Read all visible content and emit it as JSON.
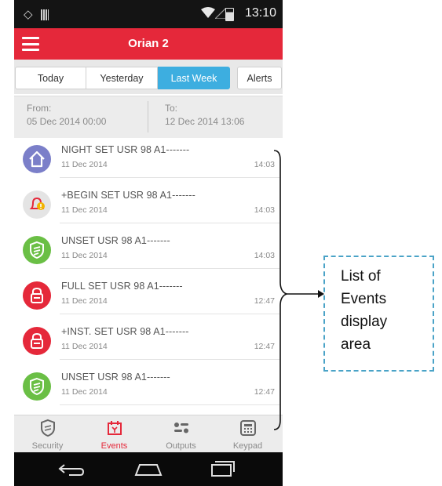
{
  "status_bar": {
    "time": "13:10"
  },
  "app_bar": {
    "title": "Orian 2"
  },
  "tabs": [
    {
      "label": "Today"
    },
    {
      "label": "Yesterday"
    },
    {
      "label": "Last Week",
      "active": true
    },
    {
      "label": "Alerts"
    }
  ],
  "date_range": {
    "from_label": "From:",
    "from_value": "05 Dec 2014  00:00",
    "to_label": "To:",
    "to_value": "12 Dec 2014  13:06"
  },
  "events": [
    {
      "name": "NIGHT SET USR 98 A1-------",
      "date": "11 Dec 2014",
      "time": "14:03",
      "icon": "home-icon",
      "color": "#7b7fc9"
    },
    {
      "name": "+BEGIN SET USR 98 A1-------",
      "date": "11 Dec 2014",
      "time": "14:03",
      "icon": "bell-alert-icon",
      "color": "#e4e4e4"
    },
    {
      "name": "UNSET USR 98 A1-------",
      "date": "11 Dec 2014",
      "time": "14:03",
      "icon": "unlock-shield-icon",
      "color": "#6abf45"
    },
    {
      "name": "FULL SET USR 98 A1-------",
      "date": "11 Dec 2014",
      "time": "12:47",
      "icon": "lock-icon",
      "color": "#e5283a"
    },
    {
      "name": "+INST. SET USR 98 A1-------",
      "date": "11 Dec 2014",
      "time": "12:47",
      "icon": "lock-icon",
      "color": "#e5283a"
    },
    {
      "name": "UNSET USR 98 A1-------",
      "date": "11 Dec 2014",
      "time": "12:47",
      "icon": "unlock-shield-icon",
      "color": "#6abf45"
    }
  ],
  "bottom_nav": [
    {
      "label": "Security",
      "icon": "shield-icon"
    },
    {
      "label": "Events",
      "icon": "events-icon",
      "active": true
    },
    {
      "label": "Outputs",
      "icon": "outputs-icon"
    },
    {
      "label": "Keypad",
      "icon": "keypad-icon"
    }
  ],
  "annotation": {
    "lines": [
      "List of",
      "Events",
      "display",
      "area"
    ]
  },
  "colors": {
    "brand": "#e5283a",
    "tab_active": "#3daee0",
    "annotation_border": "#4aa3c7"
  }
}
